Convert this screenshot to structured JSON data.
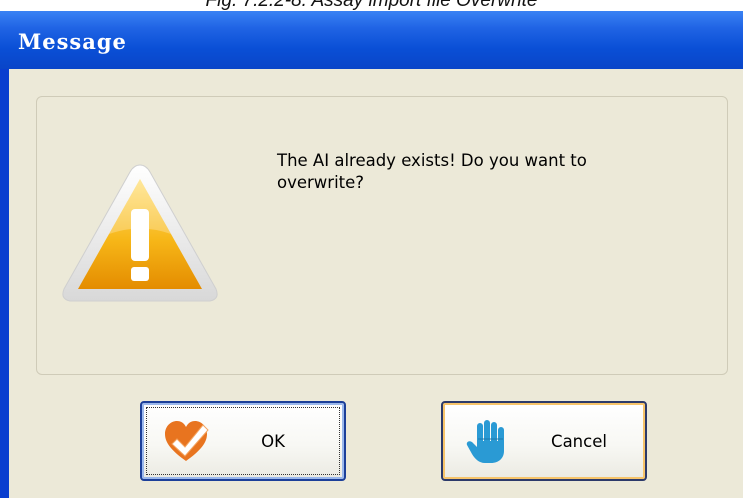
{
  "caption": "Fig. 7.2.2-8. Assay import file Overwrite",
  "dialog": {
    "title": "Message",
    "message": "The AI already exists! Do you want to overwrite?",
    "icon": "warning-icon",
    "buttons": {
      "ok_label": "OK",
      "ok_icon": "heart-check-icon",
      "cancel_label": "Cancel",
      "cancel_icon": "hand-stop-icon"
    }
  },
  "colors": {
    "title_bar": "#0a4fd6",
    "client_background": "#ece9d8",
    "warning_fill": "#f5a800",
    "ok_icon": "#e8741f",
    "cancel_icon": "#2a9ad4"
  }
}
